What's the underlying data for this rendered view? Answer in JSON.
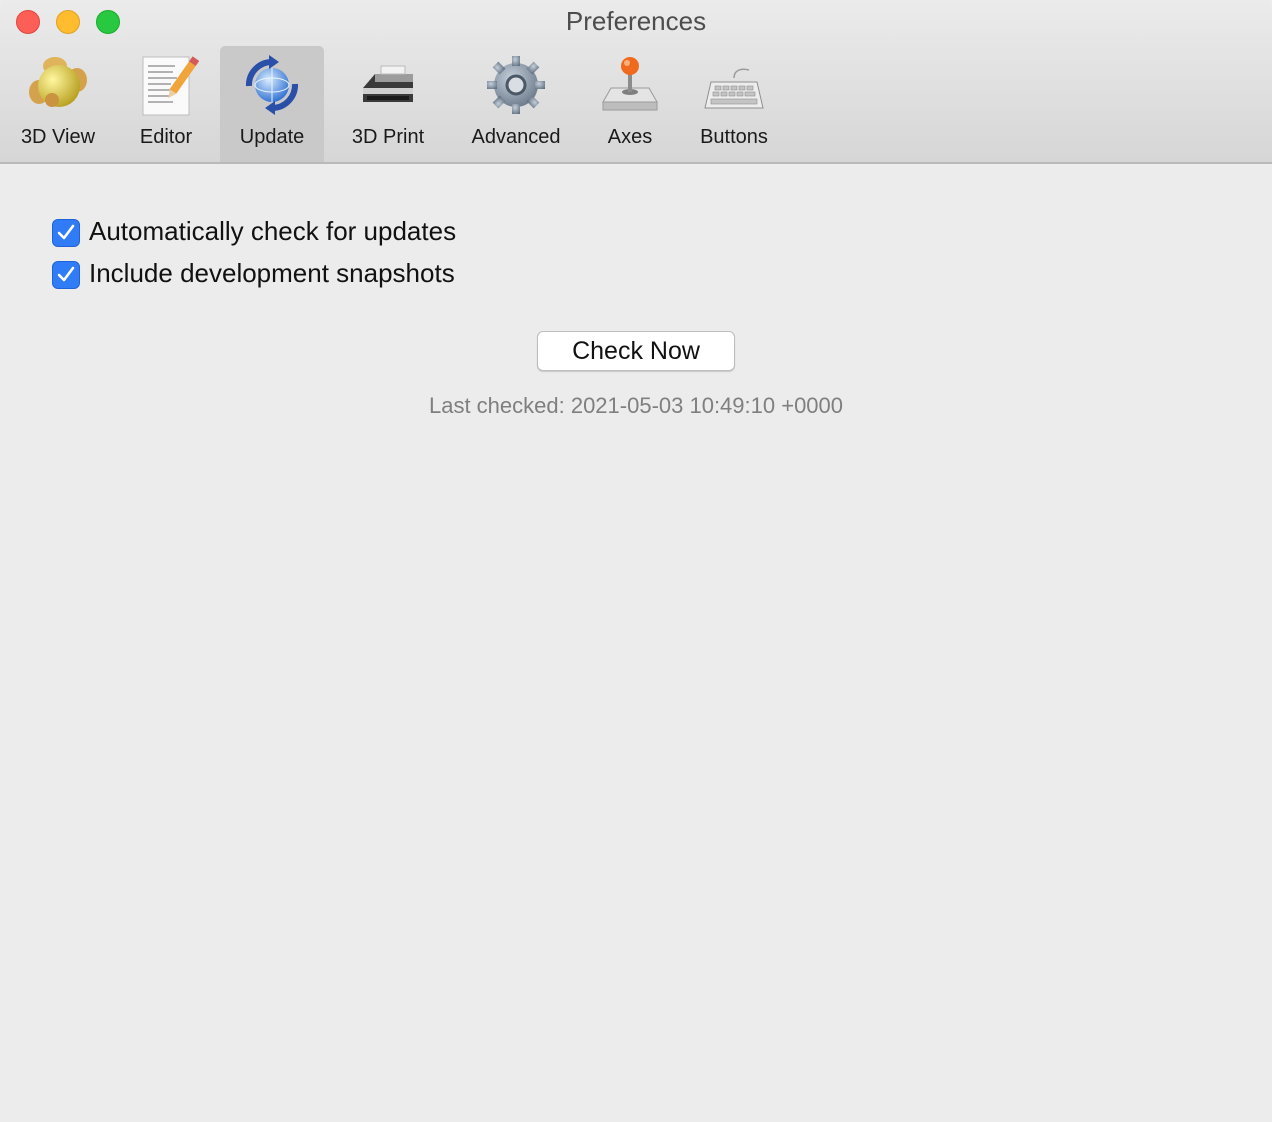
{
  "window": {
    "title": "Preferences"
  },
  "tabs": [
    {
      "label": "3D View",
      "icon": "3d-view-icon"
    },
    {
      "label": "Editor",
      "icon": "editor-icon"
    },
    {
      "label": "Update",
      "icon": "update-icon",
      "selected": true
    },
    {
      "label": "3D Print",
      "icon": "printer-icon"
    },
    {
      "label": "Advanced",
      "icon": "gear-icon"
    },
    {
      "label": "Axes",
      "icon": "joystick-icon"
    },
    {
      "label": "Buttons",
      "icon": "keyboard-icon"
    }
  ],
  "update": {
    "auto_check": {
      "label": "Automatically check for updates",
      "checked": true
    },
    "dev_snapshots": {
      "label": "Include development snapshots",
      "checked": true
    },
    "check_now_label": "Check Now",
    "last_checked": "Last checked: 2021-05-03 10:49:10 +0000"
  },
  "colors": {
    "accent": "#2f7cf6",
    "close": "#fd5f57",
    "minimize": "#febc2e",
    "maximize": "#28c840"
  }
}
